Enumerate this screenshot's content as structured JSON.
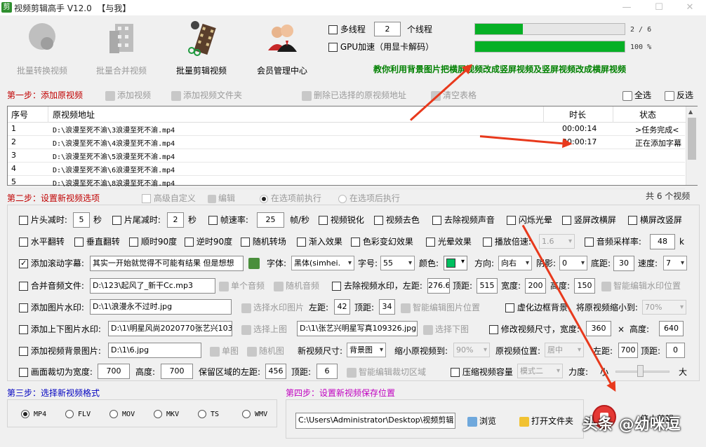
{
  "window": {
    "title": "视频剪辑高手 V12.0",
    "subtitle": "【与我】",
    "icon_text": "剪"
  },
  "toolbar": [
    {
      "label": "批量转换视频",
      "enabled": false
    },
    {
      "label": "批量合并视频",
      "enabled": false
    },
    {
      "label": "批量剪辑视频",
      "enabled": true
    },
    {
      "label": "会员管理中心",
      "enabled": true
    }
  ],
  "threads": {
    "label": "多线程",
    "value": "2",
    "unit": "个线程",
    "gpu_label": "GPU加速（用显卡解码）"
  },
  "progress": [
    {
      "text": "2 / 6",
      "fraction": 0.32
    },
    {
      "text": "100 %",
      "fraction": 1.0
    }
  ],
  "promo": "教你利用背景图片把横屏视频改成竖屏视频及竖屏视频改成横屏视频",
  "step1": {
    "title": "第一步：添加原视频",
    "add_video": "添加视频",
    "add_folder": "添加视频文件夹",
    "delete": "删除已选择的原视频地址",
    "clear": "清空表格",
    "select_all": "全选",
    "invert": "反选"
  },
  "table": {
    "headers": [
      "序号",
      "原视频地址",
      "时长",
      "状态"
    ],
    "rows": [
      [
        "1",
        "D:\\浪漫至死不渝\\3浪漫至死不渝.mp4",
        "00:00:14",
        ">任务完成<"
      ],
      [
        "2",
        "D:\\浪漫至死不渝\\4浪漫至死不渝.mp4",
        "00:00:17",
        "正在添加字幕"
      ],
      [
        "3",
        "D:\\浪漫至死不渝\\5浪漫至死不渝.mp4",
        "",
        ""
      ],
      [
        "4",
        "D:\\浪漫至死不渝\\6浪漫至死不渝.mp4",
        "",
        ""
      ],
      [
        "5",
        "D:\\浪漫至死不渝\\8浪漫至死不渝.mp4",
        "",
        ""
      ]
    ]
  },
  "step2": {
    "title": "第二步：设置新视频选项",
    "advanced": "高级自定义",
    "edit": "编辑",
    "before": "在选项前执行",
    "after": "在选项后执行",
    "count": "共 6 个视频"
  },
  "row1": {
    "head_cut": "片头减时:",
    "head_val": "5",
    "sec1": "秒",
    "tail_cut": "片尾减时:",
    "tail_val": "2",
    "sec2": "秒",
    "fps": "帧速率:",
    "fps_val": "25",
    "fps_unit": "帧/秒",
    "sharpen": "视频锐化",
    "decolor": "视频去色",
    "mute": "去除视频声音",
    "flash": "闪烁光晕",
    "v2h": "竖屏改横屏",
    "h2v": "横屏改竖屏"
  },
  "row2": {
    "hflip": "水平翻转",
    "vflip": "垂直翻转",
    "cw90": "顺时90度",
    "ccw90": "逆时90度",
    "random": "随机转场",
    "fadein": "渐入效果",
    "color": "色彩变幻效果",
    "flare": "光晕效果",
    "speed": "播放倍速:",
    "speed_val": "1.6",
    "sample": "音频采样率:",
    "sample_val": "48",
    "k": "k"
  },
  "row3": {
    "scroll": "添加滚动字幕:",
    "text": "其实一开始就觉得不可能有结果 但是想想",
    "font_lbl": "字体:",
    "font": "黑体(simhei.",
    "size_lbl": "字号:",
    "size": "55",
    "color_lbl": "颜色:",
    "dir_lbl": "方向:",
    "dir": "向右",
    "shadow_lbl": "阴影:",
    "shadow": "0",
    "bottom_lbl": "底距:",
    "bottom": "30",
    "spd_lbl": "速度:",
    "spd": "7"
  },
  "row4": {
    "merge": "合并音频文件:",
    "path": "D:\\123\\起风了_新干Cc.mp3",
    "single": "单个音频",
    "random": "随机音频",
    "remove_wm": "去除视频水印，左距:",
    "left": "276.6",
    "top_lbl": "顶距:",
    "top": "515",
    "w_lbl": "宽度:",
    "w": "200",
    "h_lbl": "高度:",
    "h": "150",
    "smart": "智能编辑水印位置"
  },
  "row5": {
    "img_wm": "添加图片水印:",
    "path": "D:\\1\\浪漫永不过时.jpg",
    "choose": "选择水印图片",
    "left_lbl": "左距:",
    "left": "42",
    "top_lbl": "顶距:",
    "top": "34",
    "smart": "智能编辑图片位置",
    "blur": "虚化边框背景，将原视频缩小到:",
    "pct": "70%"
  },
  "row6": {
    "updown": "添加上下图片水印:",
    "up_path": "D:\\1\\明星风尚2020770张艺兴103",
    "choose_up": "选择上图",
    "down_path": "D:\\1\\张艺兴明星写真109326.jpg",
    "choose_down": "选择下图",
    "resize": "修改视频尺寸，宽度:",
    "width": "360",
    "x": "×",
    "h_lbl": "高度:",
    "height": "640"
  },
  "row7": {
    "bg": "添加视频背景图片:",
    "path": "D:\\1\\6.jpg",
    "single": "单图",
    "random": "随机图",
    "size_lbl": "新视频尺寸:",
    "size": "背景图",
    "shrink_lbl": "缩小原视频到:",
    "shrink": "90%",
    "pos_lbl": "原视频位置:",
    "pos": "居中",
    "left_lbl": "左距:",
    "left": "700",
    "top_lbl": "顶距:",
    "top": "0"
  },
  "row8": {
    "crop": "画面裁切为宽度:",
    "w": "700",
    "h_lbl": "高度:",
    "h": "700",
    "keep": "保留区域的左距:",
    "left": "456",
    "top_lbl": "顶距:",
    "top": "6",
    "smart": "智能编辑裁切区域",
    "compress": "压缩视频容量",
    "mode": "模式二",
    "strength": "力度:",
    "small": "小",
    "large": "大"
  },
  "step3": {
    "title": "第三步：选择新视频格式",
    "formats": [
      "MP4",
      "FLV",
      "MOV",
      "MKV",
      "TS",
      "WMV"
    ]
  },
  "step4": {
    "title": "第四步：设置新视频保存位置",
    "path": "C:\\Users\\Administrator\\Desktop\\视频剪辑",
    "browse": "浏览",
    "open": "打开文件夹",
    "start": "停止剪辑"
  },
  "watermark": "头条 @幼咪逗",
  "colors": {
    "accent": "#06b025",
    "step1": "#c00000",
    "step2": "#c00000",
    "step3": "#0000c0",
    "step4": "#c000c0",
    "promo": "#008000",
    "arrow": "#e8391c"
  }
}
